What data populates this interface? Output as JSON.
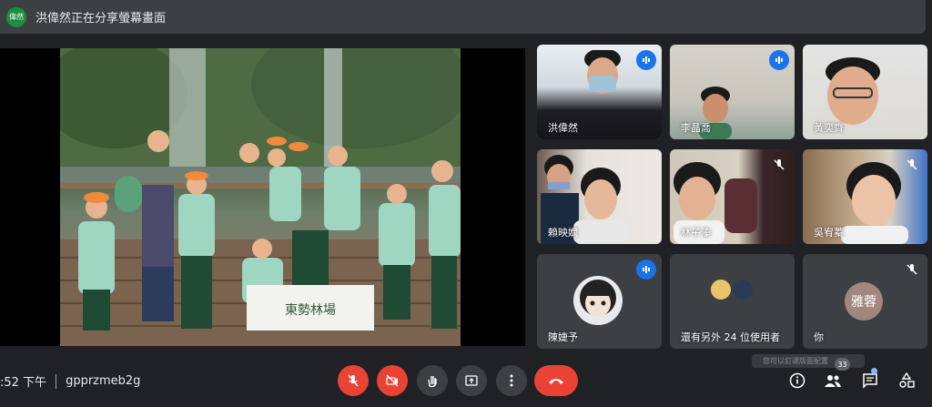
{
  "banner": {
    "avatar_label": "偉然",
    "text": "洪偉然正在分享螢幕畫面"
  },
  "shared_screen": {
    "sign_text": "東勢林場"
  },
  "participants": [
    {
      "name": "洪偉然",
      "mic": "active"
    },
    {
      "name": "李晶喬",
      "mic": "active"
    },
    {
      "name": "黃奕齊",
      "mic": "none"
    },
    {
      "name": "賴映嫻",
      "mic": "none"
    },
    {
      "name": "林子溱",
      "mic": "muted"
    },
    {
      "name": "吳宥蓁",
      "mic": "muted"
    },
    {
      "name": "陳婕予",
      "mic": "active"
    },
    {
      "name": "還有另外 24 位使用者",
      "mic": "none"
    },
    {
      "name": "你",
      "avatar_label": "雅蓉",
      "mic": "muted"
    }
  ],
  "tooltip": "您可以釘選版面配置",
  "meeting": {
    "time": ":52 下午",
    "code": "gpprzmeb2g"
  },
  "controls": {
    "mic_icon": "mic-off-icon",
    "camera_icon": "camera-off-icon",
    "hand_icon": "raise-hand-icon",
    "present_icon": "present-screen-icon",
    "more_icon": "more-vert-icon",
    "end_icon": "call-end-icon"
  },
  "side_panel": {
    "participants_count": "33"
  },
  "colors": {
    "accent": "#1a73e8",
    "danger": "#ea4335",
    "surface": "#3c4043",
    "background": "#202124"
  }
}
